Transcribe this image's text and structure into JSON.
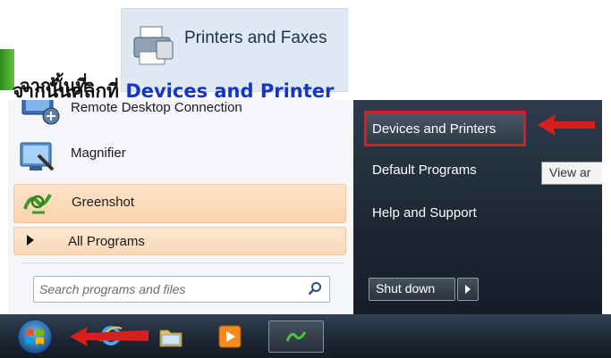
{
  "annotations": {
    "caption_1": "จากนั้นที่",
    "caption_2_prefix": "จากนั้นคลิกที่ ",
    "caption_2_highlight": "Devices  and Printer",
    "printers_faxes_label": "Printers and Faxes"
  },
  "start_menu": {
    "left_items": [
      {
        "label": "Remote Desktop Connection",
        "icon": "remote-desktop-icon"
      },
      {
        "label": "Magnifier",
        "icon": "magnifier-icon"
      },
      {
        "label": "Greenshot",
        "icon": "greenshot-icon"
      }
    ],
    "all_programs": "All Programs",
    "search": {
      "placeholder": "Search programs and files",
      "value": ""
    },
    "right_items": {
      "devices_printers": "Devices and Printers",
      "default_programs": "Default Programs",
      "help_support": "Help and Support"
    },
    "tooltip": "View ar",
    "shutdown": "Shut down"
  },
  "taskbar": {
    "icons": [
      "start-orb-icon",
      "internet-explorer-icon",
      "folder-icon",
      "media-player-icon",
      "greenshot-taskbar-icon"
    ]
  },
  "colors": {
    "highlight_blue": "#1535c9",
    "annotation_red": "#d81e1e",
    "item_hover": "#fde3c8"
  }
}
